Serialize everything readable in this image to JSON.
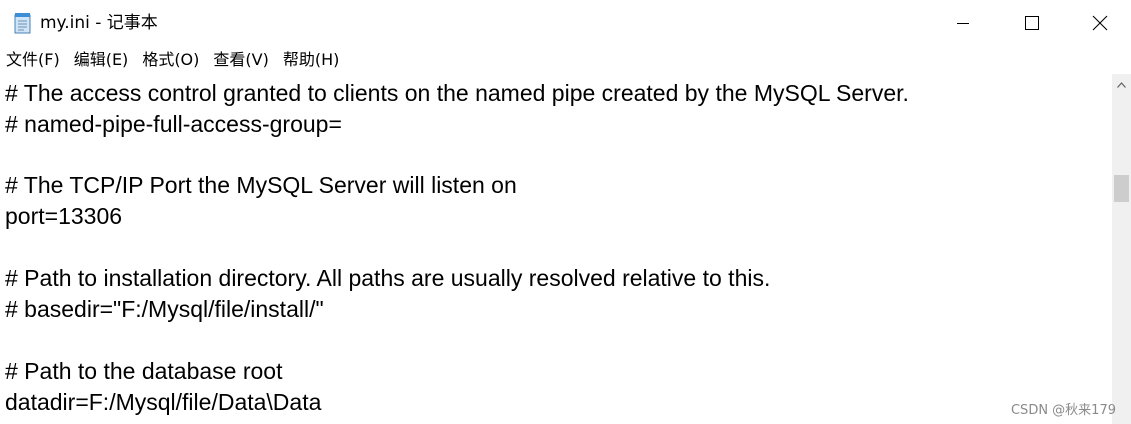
{
  "window": {
    "title": "my.ini - 记事本",
    "icon": "notepad-icon",
    "controls": {
      "minimize": "minimize-icon",
      "maximize": "maximize-icon",
      "close": "close-icon"
    }
  },
  "menubar": {
    "file": "文件(F)",
    "edit": "编辑(E)",
    "format": "格式(O)",
    "view": "查看(V)",
    "help": "帮助(H)"
  },
  "editor": {
    "lines": [
      "# The access control granted to clients on the named pipe created by the MySQL Server.",
      "# named-pipe-full-access-group=",
      "",
      "# The TCP/IP Port the MySQL Server will listen on",
      "port=13306",
      "",
      "# Path to installation directory. All paths are usually resolved relative to this.",
      "# basedir=\"F:/Mysql/file/install/\"",
      "",
      "# Path to the database root",
      "datadir=F:/Mysql/file/Data\\Data"
    ]
  },
  "scrollbar": {
    "up_arrow": "chevron-up-icon"
  },
  "watermark": "CSDN @秋来179"
}
